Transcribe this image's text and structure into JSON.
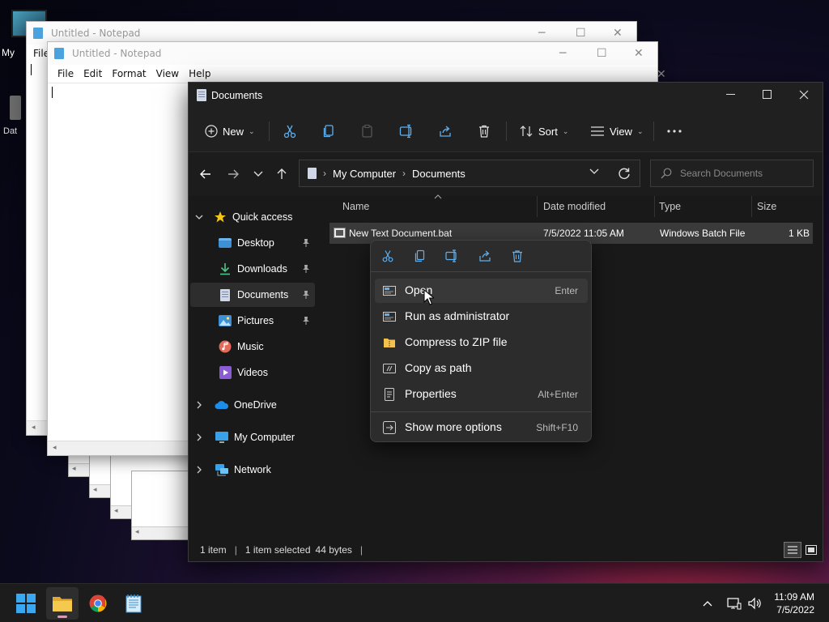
{
  "desktop": {
    "icons": [
      {
        "label": "My"
      },
      {
        "label": "Dat"
      }
    ]
  },
  "notepad_back": {
    "title": "Untitled - Notepad",
    "menu_first": "File"
  },
  "notepad_front": {
    "title": "Untitled - Notepad",
    "menu": [
      "File",
      "Edit",
      "Format",
      "View",
      "Help"
    ]
  },
  "explorer": {
    "title": "Documents",
    "toolbar": {
      "new_label": "New",
      "sort_label": "Sort",
      "view_label": "View"
    },
    "address": {
      "breadcrumb": [
        "My Computer",
        "Documents"
      ],
      "search_placeholder": "Search Documents"
    },
    "nav": {
      "quick_access": "Quick access",
      "items": [
        {
          "label": "Desktop",
          "icon": "desktop-folder-icon",
          "pinned": true
        },
        {
          "label": "Downloads",
          "icon": "downloads-folder-icon",
          "pinned": true
        },
        {
          "label": "Documents",
          "icon": "documents-folder-icon",
          "pinned": true
        },
        {
          "label": "Pictures",
          "icon": "pictures-folder-icon",
          "pinned": true
        },
        {
          "label": "Music",
          "icon": "music-folder-icon",
          "pinned": false
        },
        {
          "label": "Videos",
          "icon": "videos-folder-icon",
          "pinned": false
        }
      ],
      "onedrive": "OneDrive",
      "my_computer": "My Computer",
      "network": "Network"
    },
    "columns": [
      "Name",
      "Date modified",
      "Type",
      "Size"
    ],
    "files": [
      {
        "name": "New Text Document.bat",
        "modified": "7/5/2022 11:05 AM",
        "type": "Windows Batch File",
        "size": "1 KB"
      }
    ],
    "status": {
      "count": "1 item",
      "selected": "1 item selected",
      "size": "44 bytes"
    }
  },
  "context_menu": {
    "tools": [
      "cut-icon",
      "copy-icon",
      "rename-icon",
      "share-icon",
      "delete-icon"
    ],
    "items": [
      {
        "label": "Open",
        "shortcut": "Enter"
      },
      {
        "label": "Run as administrator",
        "shortcut": ""
      },
      {
        "label": "Compress to ZIP file",
        "shortcut": ""
      },
      {
        "label": "Copy as path",
        "shortcut": ""
      },
      {
        "label": "Properties",
        "shortcut": "Alt+Enter"
      },
      {
        "label": "Show more options",
        "shortcut": "Shift+F10"
      }
    ]
  },
  "taskbar": {
    "time": "11:09 AM",
    "date": "7/5/2022"
  },
  "colors": {
    "accent": "#0078d4",
    "folder": "#f2c14e",
    "explorer_bg": "#191919",
    "menu_bg": "#2c2c2c"
  }
}
